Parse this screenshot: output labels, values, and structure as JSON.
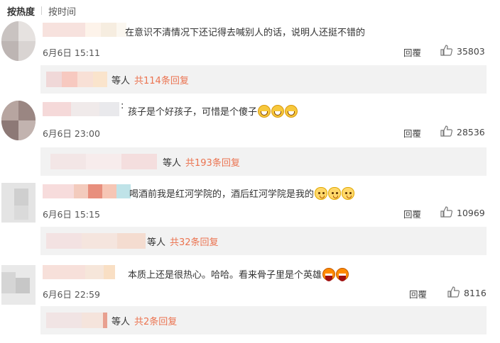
{
  "sort": {
    "active": "按热度",
    "other": "按时间"
  },
  "comments": [
    {
      "text": "在意识不清情况下还记得去喊别人的话，说明人还挺不错的",
      "time": "6月6日 15:11",
      "reply_label": "回覆",
      "likes": "35803",
      "emojis": [],
      "reply_summary": {
        "prefix": "等人",
        "count": "共114条回复"
      }
    },
    {
      "text": "孩子是个好孩子，可惜是个傻子",
      "time": "6月6日 23:00",
      "reply_label": "回覆",
      "likes": "28536",
      "emojis": [
        "laughing-crying-emoji",
        "laughing-crying-emoji",
        "laughing-crying-emoji"
      ],
      "reply_summary": {
        "prefix": "等人",
        "count": "共193条回复"
      }
    },
    {
      "text": "喝酒前我是红河学院的，酒后红河学院是我的",
      "time": "6月6日 15:15",
      "reply_label": "回覆",
      "likes": "10969",
      "emojis": [
        "cat-emoji",
        "cat-emoji",
        "cat-emoji"
      ],
      "reply_summary": {
        "prefix": "等人",
        "count": "共32条回复"
      }
    },
    {
      "text": "本质上还是很热心。哈哈。看来骨子里是个英雄",
      "time": "6月6日 22:59",
      "reply_label": "回覆",
      "likes": "8116",
      "emojis": [
        "big-grin-emoji",
        "big-grin-emoji"
      ],
      "reply_summary": {
        "prefix": "等人",
        "count": "共2条回复"
      }
    }
  ],
  "colors": {
    "accent": "#eb7350",
    "reply_bg": "#f2f2f2",
    "text": "#333333"
  }
}
